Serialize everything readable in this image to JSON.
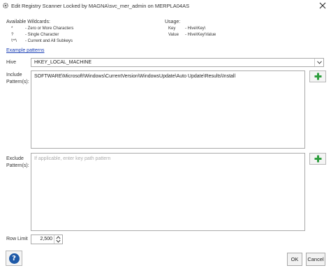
{
  "window": {
    "title": "Edit Registry Scanner Locked by MAGNA\\svc_mer_admin on MERPLA04AS"
  },
  "wildcards": {
    "title": "Available Wildcards:",
    "items": [
      {
        "symbol": "*",
        "description": "- Zero or More Characters"
      },
      {
        "symbol": "?",
        "description": "- Single Character"
      },
      {
        "symbol": "\\**\\",
        "description": "- Current and All Subkeys"
      }
    ]
  },
  "usage": {
    "title": "Usage:",
    "rows": [
      {
        "key": "Key",
        "value": "- Hive\\Key\\"
      },
      {
        "key": "Value",
        "value": "- Hive\\Key\\Value"
      }
    ]
  },
  "example_link": "Example patterns",
  "hive": {
    "label": "Hive",
    "value": "HKEY_LOCAL_MACHINE"
  },
  "include": {
    "label_line1": "Include",
    "label_line2": "Pattern(s):",
    "value": "SOFTWARE\\Microsoft\\Windows\\CurrentVersion\\WindowsUpdate\\Auto Update\\Results\\Install"
  },
  "exclude": {
    "label_line1": "Exclude",
    "label_line2": "Pattern(s):",
    "placeholder": "If applicable, enter key path pattern"
  },
  "row_limit": {
    "label": "Row Limit",
    "value": "2,500"
  },
  "buttons": {
    "help": "?",
    "ok": "OK",
    "cancel": "Cancel"
  },
  "colors": {
    "accent_link": "#1a3fb5",
    "add_icon": "#2e9e3e",
    "help_icon": "#1f5aa8"
  }
}
